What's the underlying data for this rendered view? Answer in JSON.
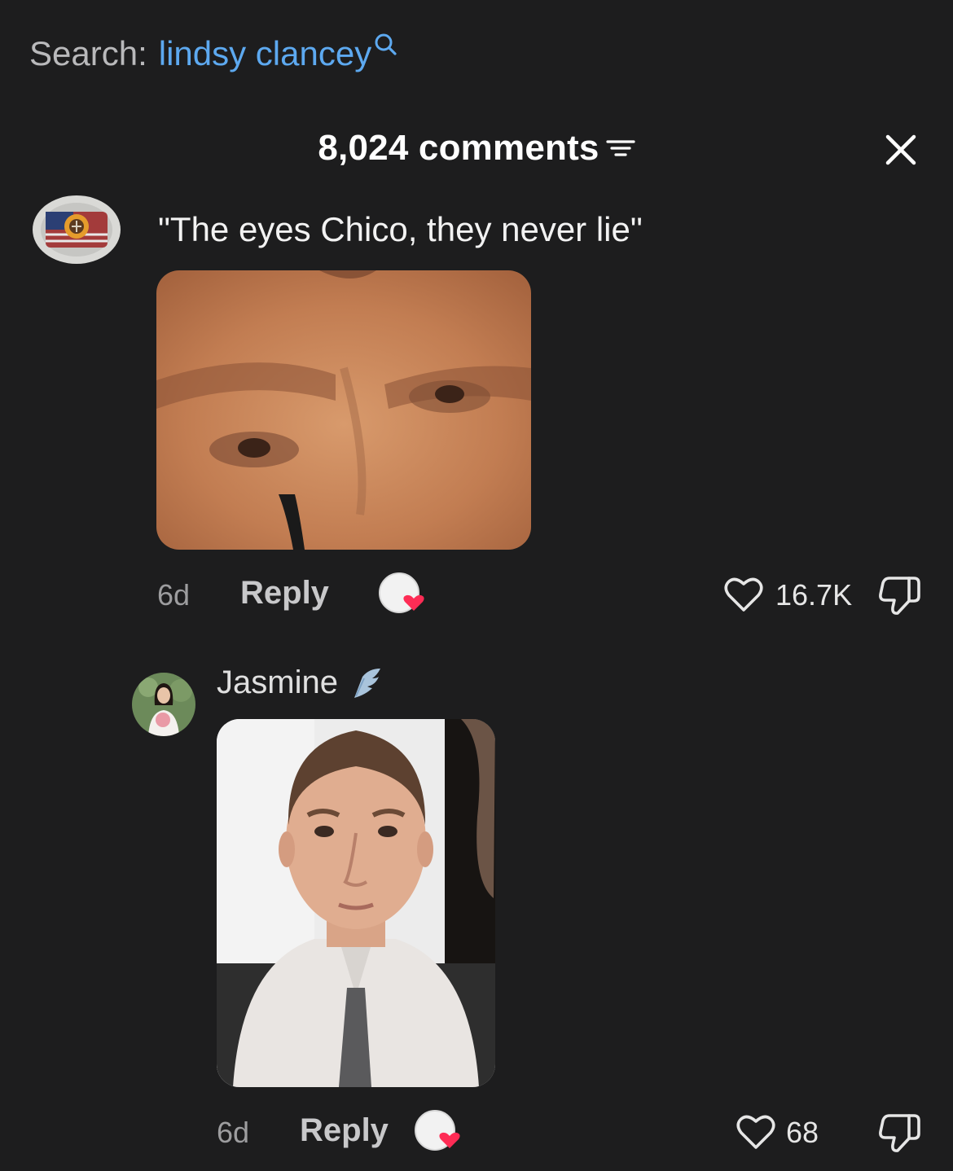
{
  "search": {
    "prefix": "Search:",
    "term": "lindsy clancey",
    "icon": "search-icon"
  },
  "header": {
    "comments_count": "8,024 comments",
    "filter_icon": "filter-icon",
    "close_icon": "close-icon"
  },
  "comments": [
    {
      "text": "\"The eyes Chico, they never lie\"",
      "time": "6d",
      "reply_label": "Reply",
      "likes": "16.7K"
    },
    {
      "username": "Jasmine",
      "time": "6d",
      "reply_label": "Reply",
      "likes": "68"
    }
  ],
  "colors": {
    "background": "#1d1d1e",
    "search_term": "#5da9f0",
    "creator_heart": "#fe2c55"
  }
}
